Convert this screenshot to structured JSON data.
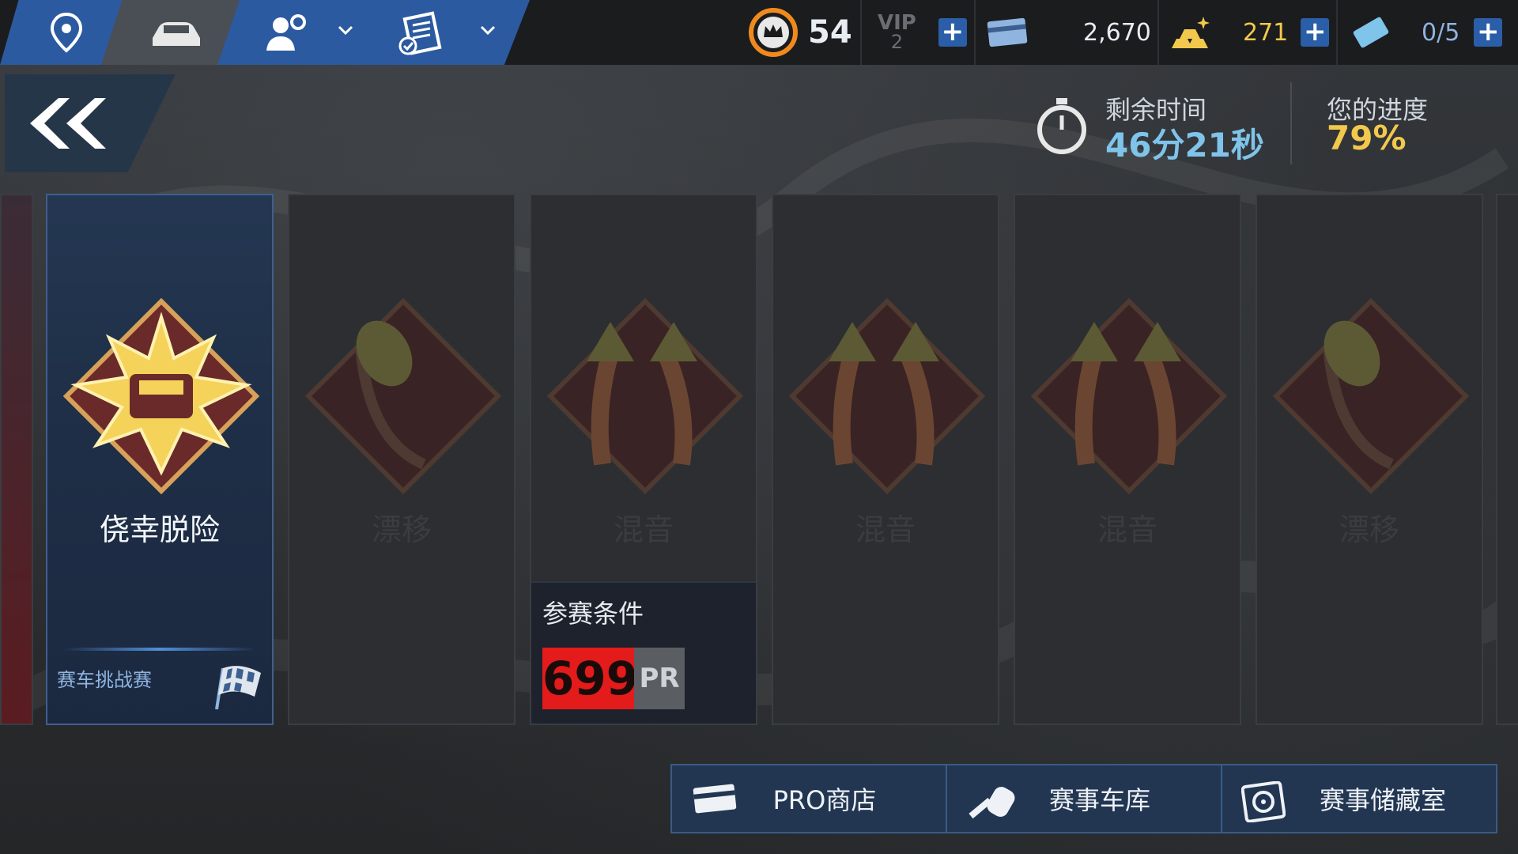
{
  "topbar": {
    "nav": [
      {
        "name": "map",
        "icon": "map-pin-icon"
      },
      {
        "name": "garage",
        "icon": "car-icon"
      },
      {
        "name": "profile",
        "icon": "profile-gear-icon"
      },
      {
        "name": "missions",
        "icon": "checklist-icon"
      }
    ],
    "level": "54",
    "vip_label": "VIP",
    "vip_level": "2",
    "cash": "2,670",
    "gold": "271",
    "tickets": "0/5"
  },
  "event": {
    "time_label": "剩余时间",
    "time_value": "46分21秒",
    "progress_label": "您的进度",
    "progress_value": "79%"
  },
  "cards": [
    {
      "label": "侥幸脱险",
      "footer": "赛车挑战赛",
      "state": "active",
      "icon": "car-burst-emblem-icon"
    },
    {
      "label": "漂移",
      "footer": "",
      "state": "locked",
      "icon": "drift-emblem-icon"
    },
    {
      "label": "混音",
      "footer": "",
      "state": "locked",
      "icon": "split-arrows-emblem-icon",
      "requirement": {
        "title": "参赛条件",
        "pr_value": "699",
        "pr_unit": "PR"
      }
    },
    {
      "label": "混音",
      "footer": "",
      "state": "locked",
      "icon": "split-arrows-emblem-icon"
    },
    {
      "label": "混音",
      "footer": "",
      "state": "locked",
      "icon": "split-arrows-emblem-icon"
    },
    {
      "label": "漂移",
      "footer": "",
      "state": "locked",
      "icon": "drift-emblem-icon"
    }
  ],
  "bottom": {
    "pro_shop": "PRO商店",
    "event_garage": "赛事车库",
    "event_vault": "赛事储藏室"
  },
  "colors": {
    "accent": "#2c5aa0",
    "gold": "#f2c94c",
    "timer": "#7fc4ea",
    "pr_red": "#e31b1b"
  }
}
